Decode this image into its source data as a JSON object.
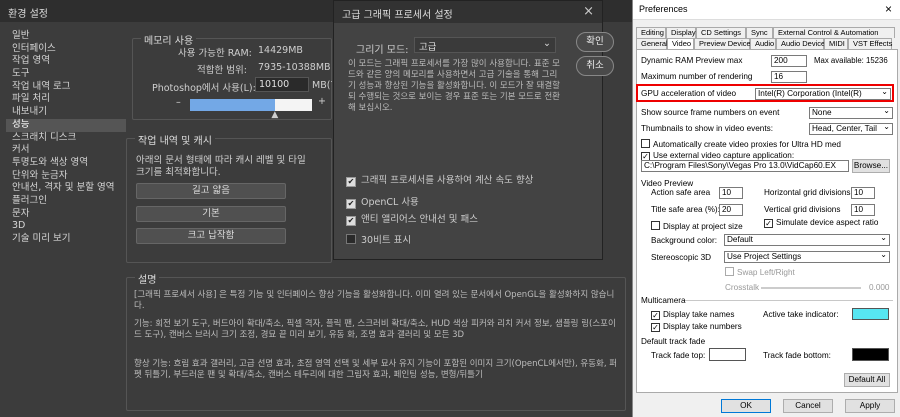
{
  "ps": {
    "title": "환경 설정",
    "close": "×",
    "sidebar": [
      "일반",
      "인터페이스",
      "작업 영역",
      "도구",
      "작업 내역 로그",
      "파일 처리",
      "내보내기",
      "성능",
      "스크래치 디스크",
      "커서",
      "투명도와 색상 영역",
      "단위와 눈금자",
      "안내선, 격자 및 분할 영역",
      "플러그인",
      "문자",
      "3D",
      "기술 미리 보기"
    ],
    "memory": {
      "title": "메모리 사용",
      "avail_label": "사용 가능한 RAM:",
      "avail_val": "14429MB",
      "ideal_label": "적합한 범위:",
      "ideal_val": "7935-10388MB",
      "use_label": "Photoshop에서 사용(L):",
      "use_val": "10100",
      "unit": "MB(70%",
      "minus": "–",
      "plus": "+",
      "fill_frac": 0.7
    },
    "history": {
      "title": "작업 내역 및 캐시",
      "desc": "아래의 문서 형태에 따라 캐시 레벨 및 타일 크기를 최적화합니다.",
      "btn1": "길고 얇음",
      "btn2": "기본",
      "btn3": "크고 납작함"
    },
    "descr": {
      "title": "설명",
      "p1": "[그래픽 프로세서 사용] 은 특정 기능 및 인터페이스 향상 기능을 활성화합니다. 이미 열려 있는 문서에서 OpenGL을 활성화하지 않습니다.",
      "p2": "기능: 회전 보기 도구, 버드아이 확대/축소, 픽셀 격자, 플릭 팬, 스크러비 확대/축소, HUD 색상 피커와 리치 커서 정보, 샘플링 링(스포이드 도구), 캔버스 브러시 크기 조정, 경묘 끝 미리 보기, 유동 화, 조명 효과 갤러리 및 모든 3D",
      "p3": "향상 기능: 흐림 효과 갤러리, 고급 선명 효과, 초점 영역 선택 및 세부 묘사 유지 기능이 포함된 이미지 크기(OpenCL에서만), 유동화, 퍼펫 뒤틀기, 부드러운 팬 및 확대/축소, 캔버스 테두리에 대한 그림자 효과, 페인팅 성능, 변형/뒤틀기"
    }
  },
  "gpu": {
    "title": "고급 그래픽 프로세서 설정",
    "close": "×",
    "mode_label": "그리기 모드:",
    "mode_val": "고급",
    "desc": "이 모드는 그래픽 프로세서를 가장 많이 사용합니다. 표준 모드와 같은 양의 메모리를 사용하면서 고급 기술을 통해 그리기 성능과 향상된 기능을 활성화합니다. 이 모드가 잘 돼결할되 수행되는 것으로 보이는 경우 표준 또는 기본 모드로 전환해 보십시오.",
    "ok": "확인",
    "cancel": "취소",
    "cb1": "그래픽 프로세서를 사용하여 계산 속도 향상",
    "cb2": "OpenCL 사용",
    "cb3": "앤티 앨리어스 안내선 및 패스",
    "cb4": "30비트 표시"
  },
  "pref": {
    "title": "Preferences",
    "close": "×",
    "tabs1": [
      "Editing",
      "Display",
      "CD Settings",
      "Sync",
      "External Control & Automation"
    ],
    "tabs2": [
      "General",
      "Video",
      "Preview Device",
      "Audio",
      "Audio Device",
      "MIDI",
      "VST Effects"
    ],
    "dyn_label": "Dynamic RAM Preview max",
    "dyn_val": "200",
    "dyn_max": "Max available: 15236",
    "maxr_label": "Maximum number of rendering",
    "maxr_val": "16",
    "gpu_label": "GPU acceleration of video",
    "gpu_val": "Intel(R) Corporation (Intel(R)",
    "show_label": "Show source frame numbers on event",
    "show_val": "None",
    "thumb_label": "Thumbnails to show in video events:",
    "thumb_val": "Head, Center, Tail",
    "auto_proxy": "Automatically create video proxies for Ultra HD med",
    "ext_cap": "Use external video capture application:",
    "path_val": "C:\\Program Files\\Sony\\Vegas Pro 13.0\\VidCap60.EX",
    "browse": "Browse...",
    "vp_title": "Video Preview",
    "action_label": "Action safe area",
    "action_val": "10",
    "hgrid_label": "Horizontal grid divisions",
    "hgrid_val": "10",
    "title_label": "Title safe area (%):",
    "title_val": "20",
    "vgrid_label": "Vertical grid divisions",
    "vgrid_val": "10",
    "disp_proj": "Display at project size",
    "sim_aspect": "Simulate device aspect ratio",
    "bg_label": "Background color:",
    "bg_val": "Default",
    "stereo_label": "Stereoscopic 3D",
    "stereo_val": "Use Project Settings",
    "swap": "Swap Left/Right",
    "cross_label": "Crosstalk",
    "cross_val": "0.000",
    "mc_title": "Multicamera",
    "disp_names": "Display take names",
    "active_label": "Active take indicator:",
    "disp_nums": "Display take numbers",
    "dtf_title": "Default track fade",
    "fade_top": "Track fade top:",
    "fade_bot": "Track fade bottom:",
    "default_all": "Default All",
    "ok": "OK",
    "cancel": "Cancel",
    "apply": "Apply",
    "cyan": "#57e6f2"
  }
}
